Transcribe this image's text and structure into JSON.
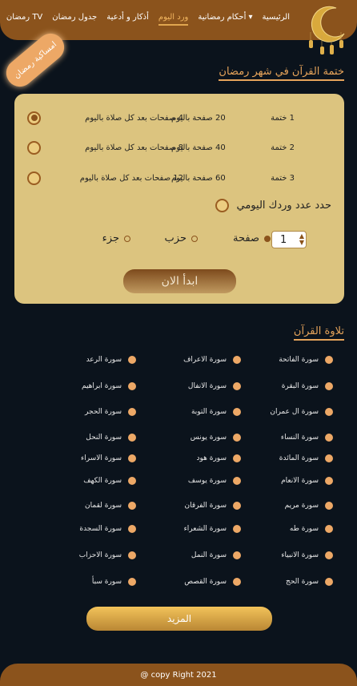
{
  "nav": {
    "items": [
      "الرئيسية",
      "أحكام رمضانية ▾",
      "ورد اليوم",
      "أذكار و أدعية",
      "جدول رمضان",
      "رمضان TV"
    ],
    "active": 2
  },
  "badge": "امساكية رمضان",
  "khatma": {
    "title": "ختمة القرآن في شهر رمضان",
    "options": [
      {
        "khatma": "1  ختمة",
        "daily": "20  صفحة باليوم",
        "per_prayer": "4  صفحات بعد كل صلاة باليوم",
        "selected": true
      },
      {
        "khatma": "2  ختمة",
        "daily": "40  صفحة باليوم",
        "per_prayer": "8  صفحات بعد كل صلاة باليوم",
        "selected": false
      },
      {
        "khatma": "3  ختمة",
        "daily": "60  صفحة باليوم",
        "per_prayer": "12 صفحات بعد كل صلاة باليوم",
        "selected": false
      }
    ],
    "custom_label": "حدد عدد وردك اليومي",
    "quantity": "1",
    "units": [
      "صفحة",
      "حزب",
      "جزء"
    ],
    "selected_unit": "صفحة",
    "start_button": "ابدأ الان"
  },
  "recitation": {
    "title": "تلاوة القرآن",
    "rows": [
      [
        "سورة الفاتحة",
        "سورة الاعراف",
        "سورة الرعد"
      ],
      [
        "سورة البقرة",
        "سورة الانفال",
        "سورة ابراهيم"
      ],
      [
        "سورة ال عمران",
        "سورة التوبة",
        "سورة الحجر"
      ],
      [
        "سورة النساء",
        "سورة يونس",
        "سورة النحل"
      ],
      [
        "سورة المائدة",
        "سورة هود",
        "سورة الاسراء"
      ],
      [
        "سورة الانعام",
        "سورة يوسف",
        "سورة الكهف"
      ],
      [
        "سورة مريم",
        "سورة الفرقان",
        "سورة لقمان"
      ],
      [
        "سورة طه",
        "سورة الشعراء",
        "سورة السجدة"
      ],
      [
        "سورة الانبياء",
        "سورة النمل",
        "سورة الاحزاب"
      ],
      [
        "سورة الحج",
        "سورة القصص",
        "سورة سبأ"
      ]
    ],
    "more_button": "المزيد"
  },
  "footer": "@ copy Right 2021",
  "colors": {
    "brand": "#8b531c",
    "accent": "#eda866",
    "card": "#dcc47f",
    "background": "#0b131c"
  }
}
